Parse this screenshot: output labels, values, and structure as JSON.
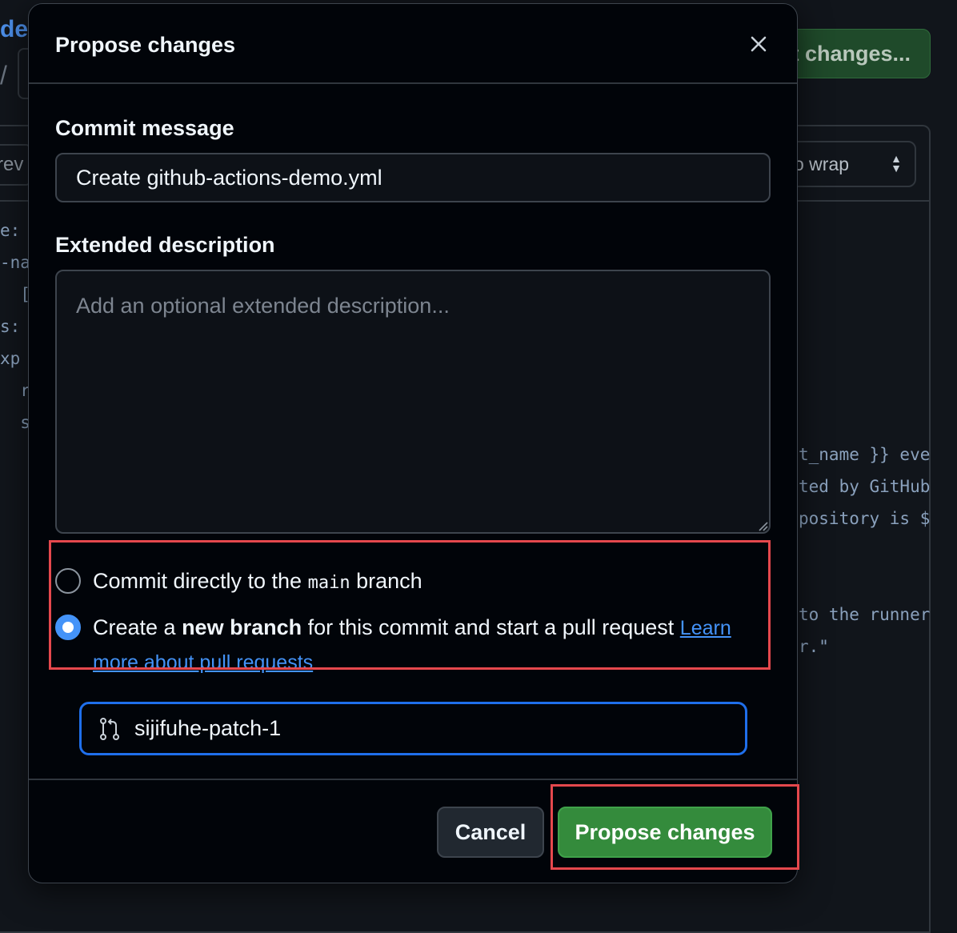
{
  "background": {
    "path_fragment": "de",
    "path_separator": "/",
    "commit_button_label": "t changes...",
    "preview_tab_label": "rev",
    "wrap_select_label": "o wrap",
    "code_left": [
      "e:",
      "-na",
      "  [p",
      "s:",
      "xp",
      "  ru",
      "  st"
    ],
    "code_right": [
      "t_name }} eve",
      "ted by GitHub",
      "pository is $",
      "",
      "",
      "to the runner",
      "r.\""
    ]
  },
  "modal": {
    "title": "Propose changes",
    "close_label": "Close",
    "commit_message": {
      "label": "Commit message",
      "value": "Create github-actions-demo.yml"
    },
    "extended_description": {
      "label": "Extended description",
      "placeholder": "Add an optional extended description..."
    },
    "options": {
      "direct": {
        "text_before": "Commit directly to the ",
        "branch_code": "main",
        "text_after": " branch",
        "selected": false
      },
      "new_branch": {
        "text_before": "Create a ",
        "bold": "new branch",
        "text_after": " for this commit and start a pull request ",
        "link": "Learn more about pull requests",
        "selected": true
      }
    },
    "branch_name": "sijifuhe-patch-1",
    "cancel_label": "Cancel",
    "propose_label": "Propose changes"
  },
  "colors": {
    "accent_blue": "#4493f8",
    "primary_green": "#348b3c",
    "highlight_red": "#e5484d"
  }
}
